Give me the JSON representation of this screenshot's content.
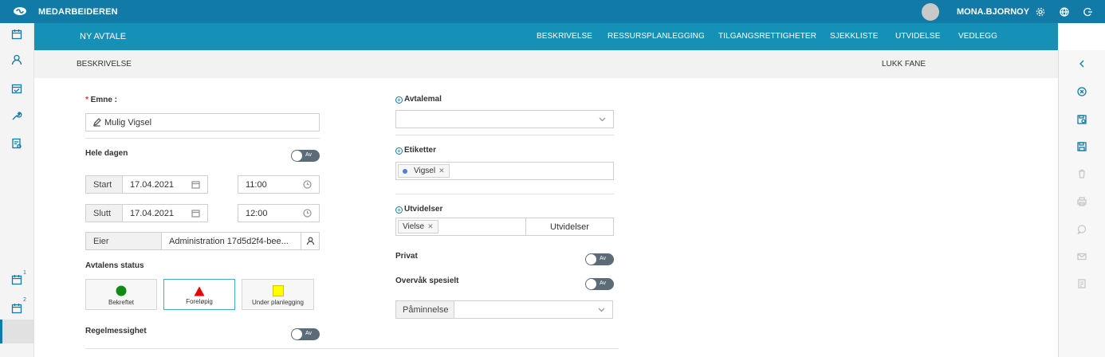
{
  "topbar": {
    "app_name": "MEDARBEIDEREN",
    "user_name": "MONA.BJORNOY",
    "icons": [
      "logo-icon",
      "settings-icon",
      "globe-icon",
      "logout-icon"
    ]
  },
  "left_rail": {
    "items": [
      "calendar-icon",
      "person-icon",
      "task-calendar-icon",
      "wrench-icon",
      "document-icon"
    ],
    "window_badges": [
      "1",
      "2"
    ]
  },
  "tabbar": {
    "title": "NY AVTALE",
    "tabs": [
      "BESKRIVELSE",
      "RESSURSPLANLEGGING",
      "TILGANGSRETTIGHETER",
      "SJEKKLISTE",
      "UTVIDELSE",
      "VEDLEGG"
    ]
  },
  "subheader": {
    "section": "BESKRIVELSE",
    "close_label": "LUKK FANE"
  },
  "form": {
    "subject_label": "Emne",
    "subject_value": "Mulig Vigsel",
    "all_day_label": "Hele dagen",
    "toggle_off_text": "Av",
    "start_label": "Start",
    "start_date": "17.04.2021",
    "start_time": "11:00",
    "end_label": "Slutt",
    "end_date": "17.04.2021",
    "end_time": "12:00",
    "owner_label": "Eier",
    "owner_value": "Administration 17d5d2f4-bee...",
    "status_label": "Avtalens status",
    "status_options": [
      {
        "label": "Bekreftet",
        "color": "#138a13",
        "shape": "circle"
      },
      {
        "label": "Foreløpig",
        "color": "#e60000",
        "shape": "triangle"
      },
      {
        "label": "Under planlegging",
        "color": "#ffff00",
        "shape": "square"
      }
    ],
    "selected_status": "Foreløpig",
    "recurrence_label": "Regelmessighet",
    "template_label": "Avtalemal",
    "tags_label": "Etiketter",
    "tags": [
      {
        "label": "Vigsel",
        "color": "#4f7fd6"
      }
    ],
    "extensions_label": "Utvidelser",
    "extension_chips": [
      "Vielse"
    ],
    "extensions_button": "Utvidelser",
    "private_label": "Privat",
    "monitor_label": "Overvåk spesielt",
    "reminder_label": "Påminnelse"
  },
  "right_rail": {
    "items": [
      "collapse-icon",
      "close-circle-icon",
      "save-close-icon",
      "save-icon",
      "delete-icon",
      "print-icon",
      "chat-icon",
      "mail-icon",
      "note-icon"
    ]
  },
  "colors": {
    "topbar": "#117aa6",
    "tabbar": "#1591b8",
    "accent": "#117aa6"
  }
}
